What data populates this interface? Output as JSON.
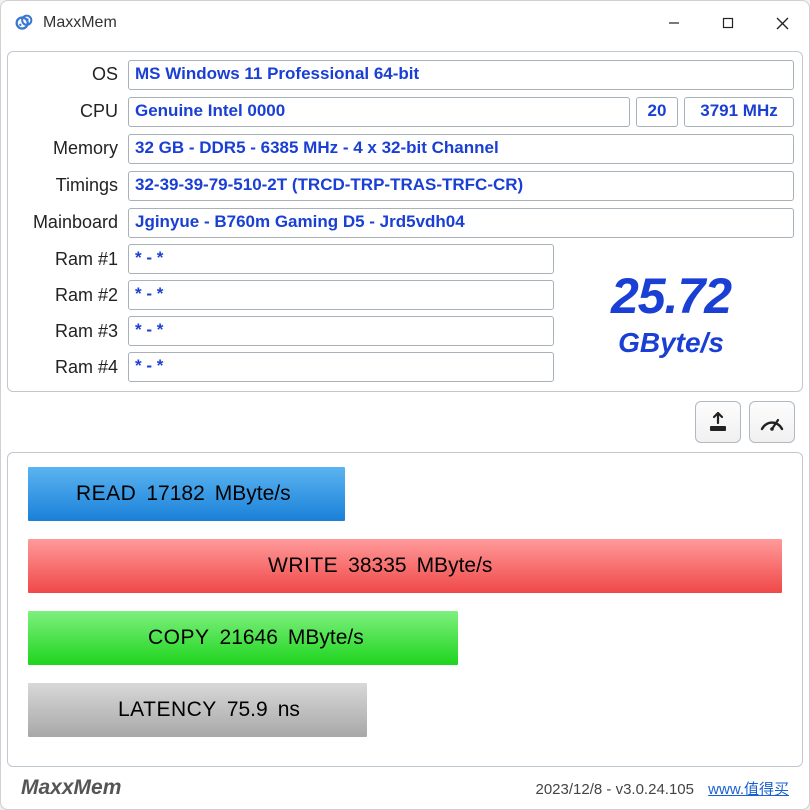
{
  "title": "MaxxMem",
  "info": {
    "os_label": "OS",
    "os": "MS Windows 11 Professional 64-bit",
    "cpu_label": "CPU",
    "cpu": "Genuine Intel 0000",
    "cpu_cores": "20",
    "cpu_mhz": "3791 MHz",
    "memory_label": "Memory",
    "memory": "32 GB - DDR5 - 6385 MHz - 4 x 32-bit Channel",
    "timings_label": "Timings",
    "timings": "32-39-39-79-510-2T (TRCD-TRP-TRAS-TRFC-CR)",
    "mainboard_label": "Mainboard",
    "mainboard": "Jginyue - B760m Gaming D5 - Jrd5vdh04",
    "ram1_label": "Ram #1",
    "ram1": "* - *",
    "ram2_label": "Ram #2",
    "ram2": "* - *",
    "ram3_label": "Ram #3",
    "ram3": "* - *",
    "ram4_label": "Ram #4",
    "ram4": "* - *"
  },
  "score": {
    "value": "25.72",
    "unit": "GByte/s"
  },
  "bars": {
    "read_label": "READ",
    "read_value": "17182",
    "read_unit": "MByte/s",
    "write_label": "WRITE",
    "write_value": "38335",
    "write_unit": "MByte/s",
    "copy_label": "COPY",
    "copy_value": "21646",
    "copy_unit": "MByte/s",
    "latency_label": "LATENCY",
    "latency_value": "75.9",
    "latency_unit": "ns"
  },
  "footer": {
    "brand": "MaxxMem",
    "date": "2023/12/8",
    "version": "v3.0.24.105",
    "link": "www.值得买"
  },
  "chart_data": {
    "type": "bar",
    "orientation": "horizontal",
    "title": "Memory Benchmark",
    "series": [
      {
        "name": "READ",
        "value": 17182,
        "unit": "MByte/s",
        "color": "#2a8ee0",
        "fill_pct": 42
      },
      {
        "name": "WRITE",
        "value": 38335,
        "unit": "MByte/s",
        "color": "#f05858",
        "fill_pct": 100
      },
      {
        "name": "COPY",
        "value": 21646,
        "unit": "MByte/s",
        "color": "#2ad82a",
        "fill_pct": 57
      },
      {
        "name": "LATENCY",
        "value": 75.9,
        "unit": "ns",
        "color": "#b8b8b8",
        "fill_pct": 45
      }
    ],
    "overall_score": {
      "value": 25.72,
      "unit": "GByte/s"
    }
  }
}
